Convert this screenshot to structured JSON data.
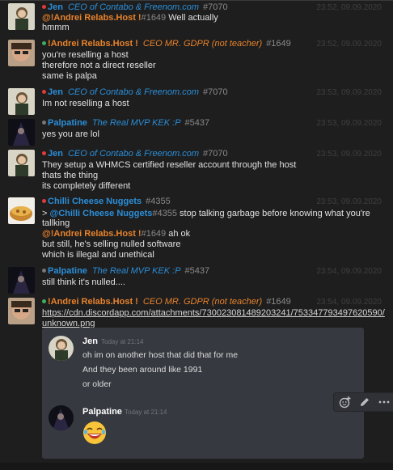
{
  "messages": [
    {
      "name": "Jen",
      "name_color": "#2b8ed8",
      "dot_color": "#e03b3b",
      "role": "CEO of Contabo & Freenom.com",
      "role_color": "#2b8ed8",
      "disc": "#7070",
      "time": "23:52, 09.09.2020",
      "reply_mention": "@!Andrei Relabs.Host !",
      "reply_mention_disc": "#1649",
      "reply_text": " Well actually",
      "lines": [
        "hmmm"
      ]
    },
    {
      "name": "!Andrei Relabs.Host !",
      "name_color": "#e8822b",
      "dot_color": "#3fae5a",
      "role": "CEO MR. GDPR (not teacher)",
      "role_color": "#e8822b",
      "disc": "#1649",
      "time": "23:52, 09.09.2020",
      "lines": [
        "you're reselling a host",
        "therefore not a direct reseller",
        "same is palpa"
      ]
    },
    {
      "name": "Jen",
      "name_color": "#2b8ed8",
      "dot_color": "#e03b3b",
      "role": "CEO of Contabo & Freenom.com",
      "role_color": "#2b8ed8",
      "disc": "#7070",
      "time": "23:53, 09.09.2020",
      "lines": [
        "Im not reselling a host"
      ]
    },
    {
      "name": "Palpatine",
      "name_color": "#2b8ed8",
      "dot_color": "#777777",
      "role": "The Real MVP KEK :P",
      "role_color": "#2b8ed8",
      "disc": "#5437",
      "time": "23:53, 09.09.2020",
      "lines": [
        "yes you are lol"
      ]
    },
    {
      "name": "Jen",
      "name_color": "#2b8ed8",
      "dot_color": "#e03b3b",
      "role": "CEO of Contabo & Freenom.com",
      "role_color": "#2b8ed8",
      "disc": "#7070",
      "time": "23:53, 09.09.2020",
      "lines": [
        "They setup a WHMCS certified reseller account through the host",
        "thats the thing",
        "its completely different"
      ]
    },
    {
      "name": "Chilli Cheese Nuggets",
      "name_color": "#2b8ed8",
      "dot_color": "#e03b3b",
      "role": "",
      "role_color": "#2b8ed8",
      "disc": "#4355",
      "time": "23:53, 09.09.2020",
      "quote_prefix": "> ",
      "quote_mention": "@Chilli Cheese Nuggets",
      "quote_mention_disc": "#4355",
      "quote_text": " stop talking garbage before knowing what you're",
      "quote_cont": "tallking",
      "reply_mention": "@!Andrei Relabs.Host !",
      "reply_mention_disc": "#1649",
      "reply_text": " ah ok",
      "lines": [
        "but still, he's selling nulled software",
        "which is illegal and unethical"
      ]
    },
    {
      "name": "Palpatine",
      "name_color": "#2b8ed8",
      "dot_color": "#777777",
      "role": "The Real MVP KEK :P",
      "role_color": "#2b8ed8",
      "disc": "#5437",
      "time": "23:54, 09.09.2020",
      "lines": [
        "still think it's nulled...."
      ]
    },
    {
      "name": "!Andrei Relabs.Host !",
      "name_color": "#e8822b",
      "dot_color": "#3fae5a",
      "role": "CEO MR. GDPR (not teacher)",
      "role_color": "#e8822b",
      "disc": "#1649",
      "time": "23:54, 09.09.2020",
      "link_line1": "https://cdn.discordapp.com/attachments/730023081489203241/753347793497620590/",
      "link_line2": "unknown.png"
    }
  ],
  "embed": {
    "m1": {
      "name": "Jen",
      "time": "Today at 21:14",
      "lines": [
        "oh im on another host that did that for me",
        "And they been around like 1991",
        "or older"
      ]
    },
    "m2": {
      "name": "Palpatine",
      "time": "Today at 21:14"
    },
    "toolbar": {
      "react_icon": "add-reaction-icon",
      "edit_icon": "pencil-icon",
      "more_icon": "more-icon"
    }
  },
  "colors": {
    "mention_orange": "#e8822b",
    "mention_blue": "#2b8ed8"
  }
}
